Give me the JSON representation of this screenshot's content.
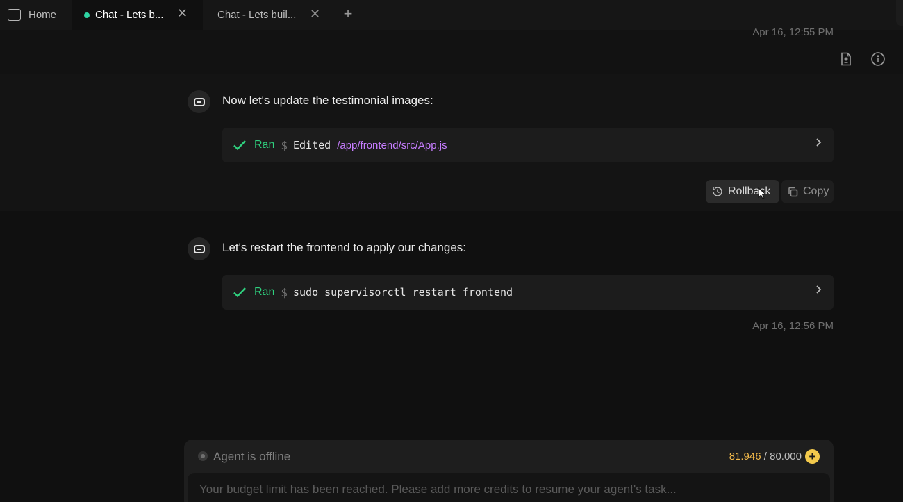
{
  "tabs": {
    "home_label": "Home",
    "active_label": "Chat - Lets b...",
    "second_label": "Chat - Lets buil..."
  },
  "header": {
    "timestamp_top": "Apr 16, 12:55 PM"
  },
  "messages": [
    {
      "text": "Now let's update the testimonial images:",
      "command": {
        "status": "Ran",
        "prompt": "$",
        "code": "Edited",
        "path": "/app/frontend/src/App.js"
      },
      "actions": {
        "rollback_label": "Rollback",
        "copy_label": "Copy"
      }
    },
    {
      "text": "Let's restart the frontend to apply our changes:",
      "command": {
        "status": "Ran",
        "prompt": "$",
        "code": "sudo supervisorctl restart frontend"
      },
      "timestamp": "Apr 16, 12:56 PM"
    }
  ],
  "composer": {
    "status": "Agent is offline",
    "credits_used": "81.946",
    "credits_sep": " / ",
    "credits_limit": "80.000",
    "placeholder": "Your budget limit has been reached. Please add more credits to resume your agent's task..."
  },
  "colors": {
    "accent_green": "#2fd07e",
    "path_purple": "#c77dff",
    "credit_yellow": "#f2c94c",
    "active_dot": "#2fd4a3"
  }
}
